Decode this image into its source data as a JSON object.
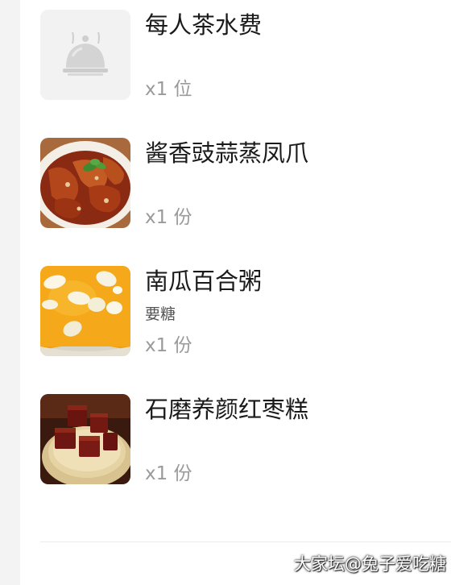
{
  "order_items": [
    {
      "name": "每人茶水费",
      "note": "",
      "quantity": "x1 位",
      "image": "placeholder-cloche-icon"
    },
    {
      "name": "酱香豉蒜蒸凤爪",
      "note": "",
      "quantity": "x1 份",
      "image": "steamed-chicken-feet-photo"
    },
    {
      "name": "南瓜百合粥",
      "note": "要糖",
      "quantity": "x1 份",
      "image": "pumpkin-lily-porridge-photo"
    },
    {
      "name": "石磨养颜红枣糕",
      "note": "",
      "quantity": "x1 份",
      "image": "red-date-cake-photo"
    }
  ],
  "watermark": "大家坛@兔子爱吃糖"
}
